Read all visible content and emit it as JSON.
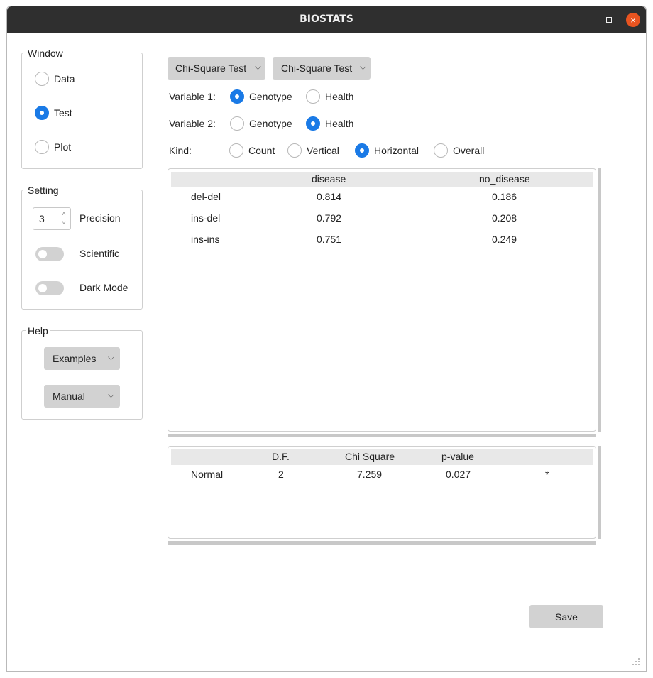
{
  "window": {
    "title": "BIOSTATS",
    "minimize_glyph": "–",
    "close_glyph": "×"
  },
  "sidebar": {
    "window_group": {
      "label": "Window",
      "options": [
        {
          "label": "Data",
          "checked": false
        },
        {
          "label": "Test",
          "checked": true
        },
        {
          "label": "Plot",
          "checked": false
        }
      ]
    },
    "setting_group": {
      "label": "Setting",
      "precision_value": "3",
      "precision_label": "Precision",
      "scientific_label": "Scientific",
      "dark_mode_label": "Dark Mode"
    },
    "help_group": {
      "label": "Help",
      "examples_label": "Examples",
      "manual_label": "Manual"
    }
  },
  "toolbar": {
    "combo1": "Chi-Square Test",
    "combo2": "Chi-Square Test"
  },
  "options": {
    "variable1_label": "Variable 1:",
    "variable1": [
      {
        "label": "Genotype",
        "checked": true
      },
      {
        "label": "Health",
        "checked": false
      }
    ],
    "variable2_label": "Variable 2:",
    "variable2": [
      {
        "label": "Genotype",
        "checked": false
      },
      {
        "label": "Health",
        "checked": true
      }
    ],
    "kind_label": "Kind:",
    "kind": [
      {
        "label": "Count",
        "checked": false
      },
      {
        "label": "Vertical",
        "checked": false
      },
      {
        "label": "Horizontal",
        "checked": true
      },
      {
        "label": "Overall",
        "checked": false
      }
    ]
  },
  "proportion_table": {
    "columns": [
      "",
      "disease",
      "no_disease"
    ],
    "rows": [
      [
        "del-del",
        "0.814",
        "0.186"
      ],
      [
        "ins-del",
        "0.792",
        "0.208"
      ],
      [
        "ins-ins",
        "0.751",
        "0.249"
      ]
    ]
  },
  "result_table": {
    "columns": [
      "",
      "D.F.",
      "Chi Square",
      "p-value",
      ""
    ],
    "rows": [
      [
        "Normal",
        "2",
        "7.259",
        "0.027",
        "*"
      ]
    ]
  },
  "save_label": "Save",
  "colors": {
    "accent": "#1a7ae6",
    "titlebar": "#2f2f2f",
    "close_button": "#e95420",
    "button_bg": "#d2d2d2",
    "header_bg": "#e8e8e8"
  },
  "icons": {
    "minimize": "minimize-icon",
    "maximize": "maximize-icon",
    "close": "close-icon",
    "chevron": "chevron-down-icon",
    "resize": "resize-grip-icon"
  }
}
